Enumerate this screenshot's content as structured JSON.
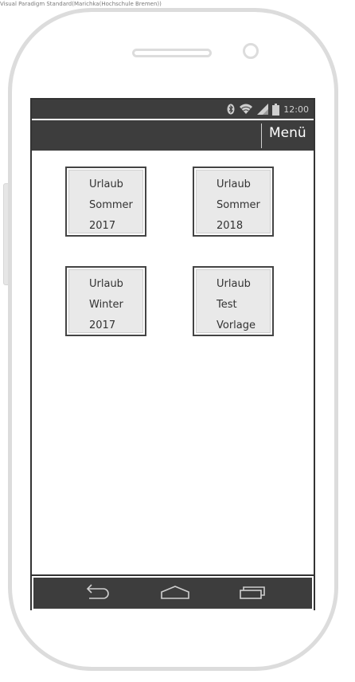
{
  "watermark": "Visual Paradigm Standard(Marichka(Hochschule Bremen))",
  "status_bar": {
    "time": "12:00",
    "icons": [
      "bluetooth-icon",
      "wifi-icon",
      "signal-icon",
      "battery-icon"
    ]
  },
  "app_bar": {
    "menu_label": "Menü"
  },
  "tiles": [
    {
      "lines": [
        "Urlaub",
        "Sommer",
        "2017"
      ]
    },
    {
      "lines": [
        "Urlaub",
        "Sommer",
        "2018"
      ]
    },
    {
      "lines": [
        "Urlaub",
        "Winter",
        "2017"
      ]
    },
    {
      "lines": [
        "Urlaub",
        "Test",
        "Vorlage"
      ]
    }
  ],
  "nav_bar": {
    "icons": [
      "back-icon",
      "home-icon",
      "recent-apps-icon"
    ]
  },
  "colors": {
    "bar": "#3d3d3d",
    "tile_fill": "#e9e9e9",
    "phone_outline": "#dcdcdc"
  }
}
